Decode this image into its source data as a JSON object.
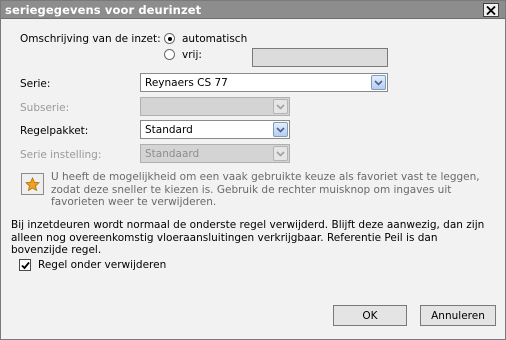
{
  "dialog": {
    "title": "seriegegevens voor deurinzet"
  },
  "description": {
    "label": "Omschrijving van de inzet:",
    "option_auto": "automatisch",
    "option_free": "vrij:",
    "selected": "automatisch",
    "free_value": ""
  },
  "fields": {
    "serie": {
      "label": "Serie:",
      "value": "Reynaers CS 77",
      "enabled": true
    },
    "subserie": {
      "label": "Subserie:",
      "value": "",
      "enabled": false
    },
    "regelpakket": {
      "label": "Regelpakket:",
      "value": "Standard",
      "enabled": true
    },
    "serie_instelling": {
      "label": "Serie instelling:",
      "value": "Standaard",
      "enabled": false
    }
  },
  "favorites": {
    "hint": "U heeft de mogelijkheid om een vaak gebruikte keuze als favoriet vast te leggen, zodat deze sneller te kiezen is. Gebruik de rechter muisknop om ingaves uit favorieten weer te verwijderen.",
    "icon": "star-icon",
    "icon_color": "#f0a020"
  },
  "info_text": "Bij inzetdeuren wordt normaal de onderste regel verwijderd. Blijft deze aanwezig, dan zijn alleen nog overeenkomstig vloeraansluitingen verkrijgbaar. Referentie Peil is dan bovenzijde regel.",
  "checkbox": {
    "label": "Regel onder verwijderen",
    "checked": true
  },
  "buttons": {
    "ok": "OK",
    "cancel": "Annuleren"
  }
}
